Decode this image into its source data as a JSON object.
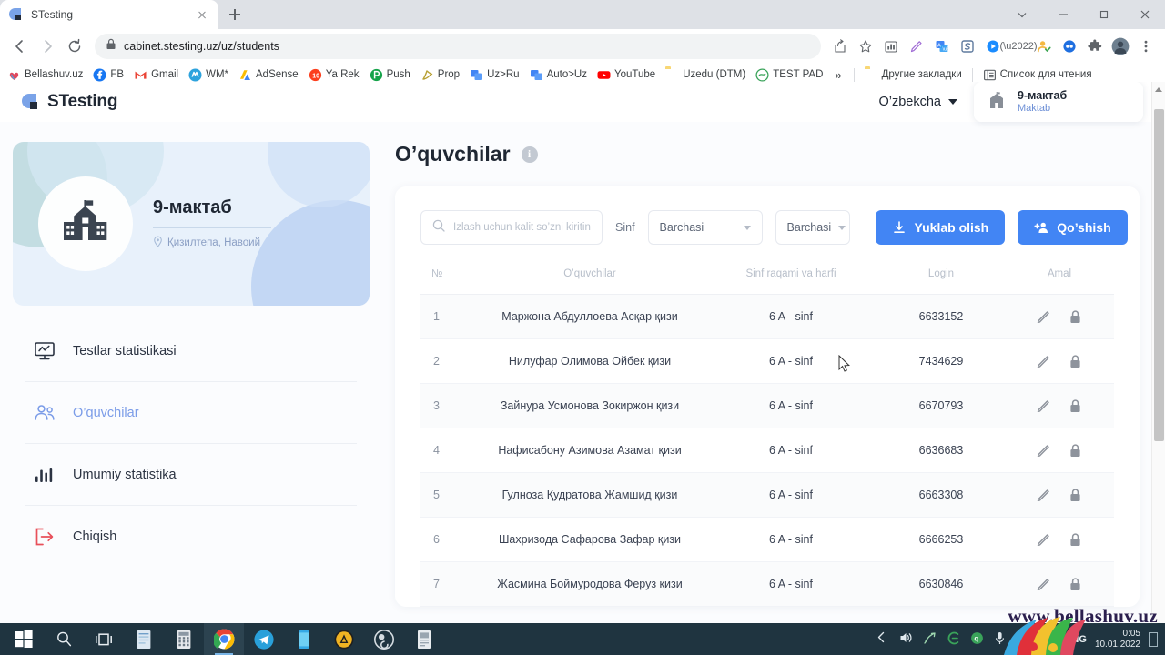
{
  "browser": {
    "tab": {
      "title": "STesting",
      "favicon": "stesting-favicon"
    },
    "new_tab_label": "+",
    "url": "cabinet.stesting.uz/uz/students",
    "nav": {
      "back": "back-arrow",
      "forward": "forward-arrow",
      "reload": "reload-arrow"
    },
    "lock_icon": "lock-icon",
    "toolbar_icons": [
      "share-icon",
      "bookmark-star-icon",
      "analytics-icon",
      "pen-icon",
      "translate-icon",
      "s-app-icon",
      "player-icon",
      "equalizer-icon",
      "profile-check-icon",
      "chat-bubbles-icon",
      "extensions-puzzle-icon",
      "avatar-icon",
      "chrome-menu-icon"
    ],
    "window_controls": [
      "minimize-to-tray",
      "minimize",
      "maximize",
      "close"
    ],
    "bookmarks": [
      {
        "label": "Bellashuv.uz",
        "icon": "bellashuv-icon"
      },
      {
        "label": "FB",
        "icon": "facebook-icon"
      },
      {
        "label": "Gmail",
        "icon": "gmail-icon"
      },
      {
        "label": "WM*",
        "icon": "webmoney-icon"
      },
      {
        "label": "AdSense",
        "icon": "adsense-icon"
      },
      {
        "label": "Ya Rek",
        "icon": "yandex-direct-icon"
      },
      {
        "label": "Push",
        "icon": "push-icon"
      },
      {
        "label": "Prop",
        "icon": "prop-icon"
      },
      {
        "label": "Uz>Ru",
        "icon": "translate-uzru-icon"
      },
      {
        "label": "Auto>Uz",
        "icon": "translate-autouz-icon"
      },
      {
        "label": "YouTube",
        "icon": "youtube-icon"
      },
      {
        "label": "Uzedu (DTM)",
        "icon": "folder-icon"
      },
      {
        "label": "TEST PAD",
        "icon": "testpad-icon"
      }
    ],
    "bookmarks_overflow": "»",
    "other_bookmarks": {
      "label": "Другие закладки",
      "icon": "folder-icon"
    },
    "reading_list": {
      "label": "Список для чтения",
      "icon": "reading-list-icon"
    }
  },
  "site": {
    "logo_text": "STesting",
    "language": {
      "label": "O’zbekcha",
      "icon": "chevron-down-icon"
    },
    "user_card": {
      "name": "9-мактаб",
      "role": "Maktab",
      "icon": "school-icon"
    }
  },
  "sidebar": {
    "school": {
      "name": "9-мактаб",
      "location": "Қизилтепа, Навоий",
      "location_icon": "map-pin-icon",
      "avatar_icon": "school-building-icon"
    },
    "items": [
      {
        "label": "Testlar statistikasi",
        "icon": "presentation-chart-icon",
        "active": false
      },
      {
        "label": "O’quvchilar",
        "icon": "users-icon",
        "active": true
      },
      {
        "label": "Umumiy statistika",
        "icon": "bar-chart-icon",
        "active": false
      },
      {
        "label": "Chiqish",
        "icon": "logout-icon",
        "active": false
      }
    ]
  },
  "main": {
    "page_title": "O’quvchilar",
    "info_icon": "info-icon",
    "toolbar": {
      "search_placeholder": "Izlash uchun kalit so’zni kiriting",
      "search_value": "",
      "search_icon": "search-icon",
      "sinf_label": "Sinf",
      "class_select_value": "Barchasi",
      "letter_select_value": "Barchasi",
      "download_button": {
        "label": "Yuklab olish",
        "icon": "download-icon"
      },
      "add_button": {
        "label": "Qo’shish",
        "icon": "add-user-icon"
      }
    },
    "table": {
      "columns": [
        "№",
        "O’quvchilar",
        "Sinf raqami va harfi",
        "Login",
        "Amal"
      ],
      "row_action_icons": [
        "edit-pencil-icon",
        "lock-icon"
      ],
      "rows": [
        {
          "num": "1",
          "name": "Маржона Абдуллоева Асқар қизи",
          "class": "6 A - sinf",
          "login": "6633152"
        },
        {
          "num": "2",
          "name": "Нилуфар Олимова Ойбек қизи",
          "class": "6 A - sinf",
          "login": "7434629"
        },
        {
          "num": "3",
          "name": "Зайнура Усмонова Зокиржон қизи",
          "class": "6 A - sinf",
          "login": "6670793"
        },
        {
          "num": "4",
          "name": "Нафисабону Азимова Азамат қизи",
          "class": "6 A - sinf",
          "login": "6636683"
        },
        {
          "num": "5",
          "name": "Гулноза Қудратова Жамшид қизи",
          "class": "6 A - sinf",
          "login": "6663308"
        },
        {
          "num": "6",
          "name": "Шахризода Сафарова Зафар қизи",
          "class": "6 A - sinf",
          "login": "6666253"
        },
        {
          "num": "7",
          "name": "Жасмина Боймуродова Феруз қизи",
          "class": "6 A - sinf",
          "login": "6630846"
        }
      ]
    }
  },
  "overlay": {
    "watermark": "www.bellashuv.uz"
  },
  "taskbar": {
    "items": [
      {
        "icon": "windows-start-icon",
        "active": false
      },
      {
        "icon": "search-icon",
        "active": false
      },
      {
        "icon": "task-view-icon",
        "active": false
      },
      {
        "icon": "notepad-icon",
        "active": false
      },
      {
        "icon": "calculator-icon",
        "active": false
      },
      {
        "icon": "chrome-icon",
        "active": true
      },
      {
        "icon": "telegram-icon",
        "active": false
      },
      {
        "icon": "phone-link-icon",
        "active": false
      },
      {
        "icon": "autodesk-icon",
        "active": false
      },
      {
        "icon": "obs-icon",
        "active": false
      },
      {
        "icon": "document-icon",
        "active": false
      }
    ],
    "tray": {
      "icons": [
        "show-hidden-icon",
        "volume-icon",
        "network-share-icon",
        "eset-icon",
        "qbittorrent-icon",
        "microphone-icon",
        "weather-icon",
        "wifi-icon"
      ],
      "language": "ENG",
      "time": "0:05",
      "date": "10.01.2022",
      "show_desktop": "show-desktop-button"
    }
  },
  "colors": {
    "accent_blue": "#4285f4",
    "link_blue": "#7b9ce8",
    "logout_red": "#e8505b",
    "card_bg": "#e8f1fb",
    "taskbar": "#1f3440"
  }
}
